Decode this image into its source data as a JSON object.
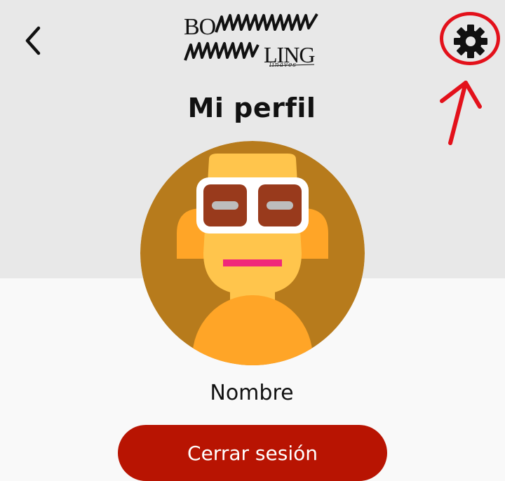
{
  "header": {
    "back_icon": "chevron-left-icon",
    "logo": {
      "text_top": "BO",
      "text_bottom": "LING",
      "tagline": "linaves"
    },
    "settings_icon": "gear-icon"
  },
  "annotation": {
    "highlight_color": "#e3111b",
    "arrow_icon": "arrow-up-icon"
  },
  "profile": {
    "title": "Mi perfil",
    "avatar_icon": "avatar-with-glasses",
    "name": "Nombre"
  },
  "actions": {
    "logout_label": "Cerrar sesión"
  },
  "colors": {
    "header_bg": "#e8e8e8",
    "page_bg": "#f9f9f9",
    "logout_bg": "#b81402",
    "avatar_bg": "#b77b1c",
    "avatar_skin": "#ffc54c",
    "avatar_hair": "#ffa527",
    "avatar_lenses": "#993a1c",
    "avatar_mouth": "#f0287a"
  }
}
